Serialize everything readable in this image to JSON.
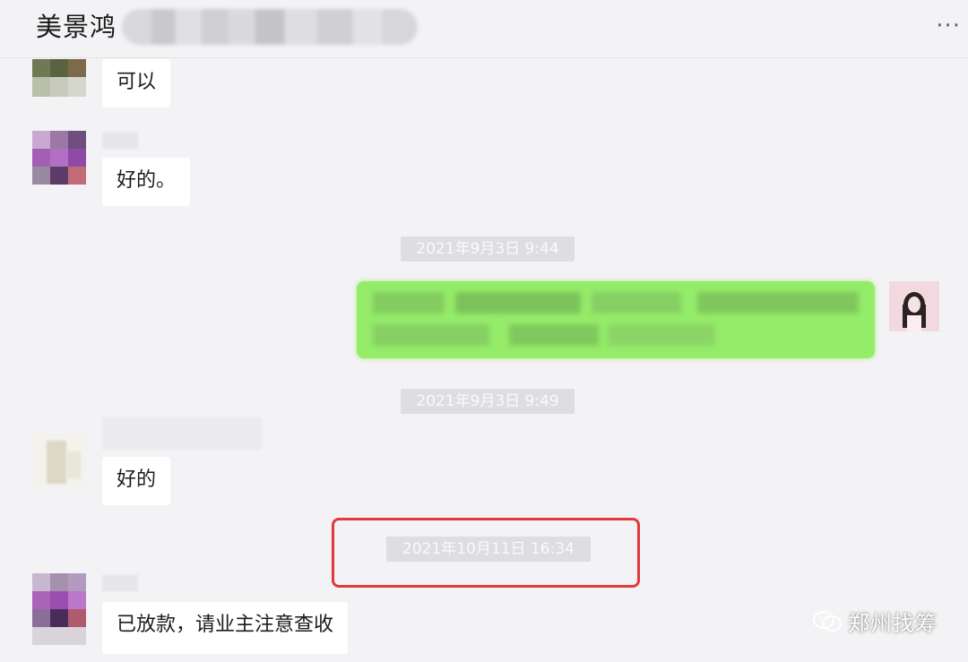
{
  "header": {
    "title": "美景鸿",
    "more_icon": "more-dots-icon",
    "more_label": "···"
  },
  "messages": [
    {
      "direction": "in",
      "text": "可以"
    },
    {
      "direction": "in",
      "text": "好的。"
    },
    {
      "timestamp": "2021年9月3日 9:44"
    },
    {
      "direction": "out",
      "text": ""
    },
    {
      "timestamp": "2021年9月3日 9:49"
    },
    {
      "direction": "in",
      "text": "好的"
    },
    {
      "timestamp": "2021年10月11日 16:34"
    },
    {
      "direction": "in",
      "text": "已放款，请业主注意查收"
    }
  ],
  "watermark": {
    "icon": "wechat-icon",
    "text": "郑州找筹"
  },
  "colors": {
    "background": "#f3f2f5",
    "outgoing_bubble": "#95ec69",
    "incoming_bubble": "#ffffff",
    "highlight_box": "#e23a3a"
  }
}
